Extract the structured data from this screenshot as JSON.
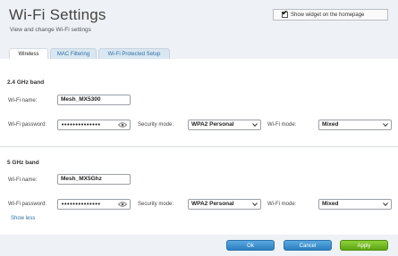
{
  "header": {
    "title": "Wi-Fi Settings",
    "subtitle": "View and change Wi-Fi settings",
    "show_widget_label": "Show widget on the homepage",
    "show_widget_checked": true
  },
  "tabs": [
    {
      "label": "Wireless",
      "active": true
    },
    {
      "label": "MAC Filtering",
      "active": false
    },
    {
      "label": "Wi-Fi Protected Setup",
      "active": false
    }
  ],
  "band_24": {
    "title": "2.4 GHz band",
    "name_label": "Wi-Fi name:",
    "name_value": "Mesh_MX5300",
    "password_label": "Wi-Fi password:",
    "password_value": "••••••••••••••",
    "security_label": "Security mode:",
    "security_value": "WPA2 Personal",
    "mode_label": "Wi-Fi mode:",
    "mode_value": "Mixed"
  },
  "band_5": {
    "title": "5 GHz band",
    "name_label": "Wi-Fi name:",
    "name_value": "Mesh_MX5Ghz",
    "password_label": "Wi-Fi password:",
    "password_value": "••••••••••••••",
    "security_label": "Security mode:",
    "security_value": "WPA2 Personal",
    "mode_label": "Wi-Fi mode:",
    "mode_value": "Mixed"
  },
  "show_less": "Show less",
  "footer": {
    "ok": "Ok",
    "cancel": "Cancel",
    "apply": "Apply"
  },
  "colors": {
    "accent_blue": "#2c7fc1",
    "apply_green": "#5da512",
    "link_blue": "#2f6fa3"
  }
}
